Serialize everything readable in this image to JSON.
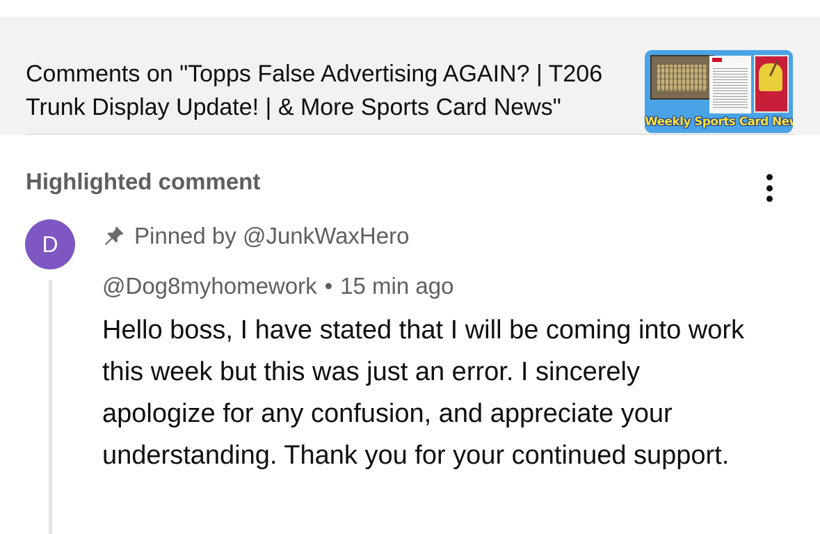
{
  "header": {
    "title": "Comments on \"Topps False Advertising AGAIN? | T206 Trunk Display Update! | & More Sports Card News\"",
    "thumbnail_caption": "Weekly Sports Card News!"
  },
  "highlighted": {
    "section_title": "Highlighted comment",
    "menu_icon": "more-vert-icon"
  },
  "comment": {
    "avatar_letter": "D",
    "avatar_color": "#7e57c2",
    "pinned_text": "Pinned by @JunkWaxHero",
    "author": "@Dog8myhomework",
    "separator": "•",
    "time": "15 min ago",
    "body": "Hello boss, I have stated that I will be coming into work this week but this was just an error. I sincerely apologize for any confusion, and appreciate your understanding. Thank you for your continued support."
  }
}
